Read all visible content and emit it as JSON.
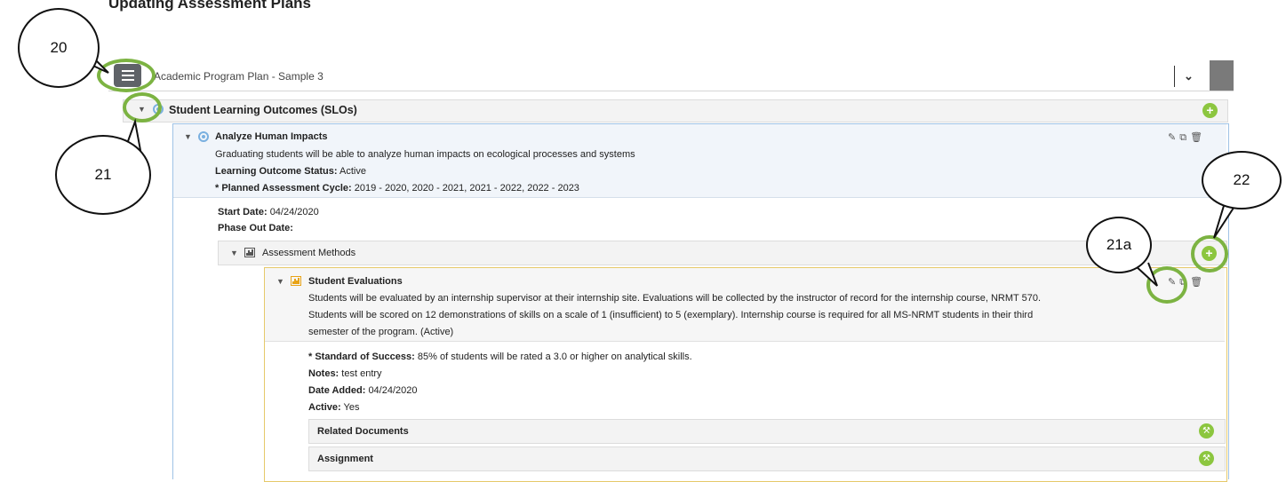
{
  "document": {
    "heading": "Updating Assessment Plans"
  },
  "header": {
    "plan_title": "Academic Program Plan - Sample 3",
    "menu_icon": "hamburger-menu-icon",
    "dropdown_icon": "chevron-down-icon"
  },
  "slo_section": {
    "label": "Student Learning Outcomes (SLOs)"
  },
  "outcome": {
    "title": "Analyze Human Impacts",
    "description": "Graduating students will be able to analyze human impacts on ecological processes and systems",
    "status_label": "Learning Outcome Status:",
    "status_value": "Active",
    "cycle_label": "* Planned Assessment Cycle:",
    "cycle_value": "2019 - 2020, 2020 - 2021, 2021 - 2022, 2022 - 2023",
    "start_label": "Start Date:",
    "start_value": "04/24/2020",
    "phase_out_label": "Phase Out Date:",
    "phase_out_value": ""
  },
  "methods": {
    "label": "Assessment Methods"
  },
  "evaluation": {
    "title": "Student Evaluations",
    "line1": "Students will be evaluated by an internship supervisor at their internship site. Evaluations will be collected by the instructor of record for the internship course, NRMT 570.",
    "line2": "Students will be scored on 12 demonstrations of skills on a scale of 1 (insufficient) to 5 (exemplary). Internship course is required for all MS-NRMT students in their third",
    "line3": "semester of the program. (Active)",
    "success_label": "* Standard of Success:",
    "success_value": "85% of students will be rated a 3.0 or higher on analytical skills.",
    "notes_label": "Notes:",
    "notes_value": "test entry",
    "date_label": "Date Added:",
    "date_value": "04/24/2020",
    "active_label": "Active:",
    "active_value": "Yes"
  },
  "sub_sections": {
    "related_docs": "Related Documents",
    "assignment": "Assignment"
  },
  "callouts": {
    "c20": "20",
    "c21": "21",
    "c21a": "21a",
    "c22": "22"
  },
  "colors": {
    "accent_green": "#8cc63f",
    "highlight_ring": "#7cb342",
    "outcome_border": "#9fc3e6",
    "evaluation_border": "#e6c96a"
  }
}
